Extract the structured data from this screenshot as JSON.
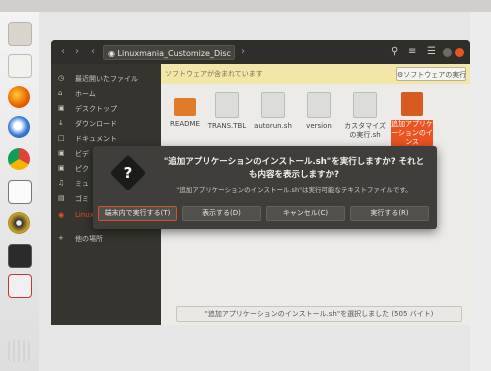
{
  "window": {
    "path_label": "Linuxmania_Customize_Disc"
  },
  "sidebar": {
    "items": [
      {
        "label": "最近開いたファイル",
        "icon": "clock-icon"
      },
      {
        "label": "ホーム",
        "icon": "home-icon"
      },
      {
        "label": "デスクトップ",
        "icon": "folder-icon"
      },
      {
        "label": "ダウンロード",
        "icon": "download-icon"
      },
      {
        "label": "ドキュメント",
        "icon": "document-icon"
      },
      {
        "label": "ビデ",
        "icon": "video-icon"
      },
      {
        "label": "ピク",
        "icon": "picture-icon"
      },
      {
        "label": "ミュ",
        "icon": "music-icon"
      },
      {
        "label": "ゴミ",
        "icon": "trash-icon"
      },
      {
        "label": "Linux",
        "icon": "disc-icon"
      },
      {
        "label": "他の場所",
        "icon": "plus-icon"
      }
    ]
  },
  "infobar": {
    "message": "ソフトウェアが含まれています",
    "button_label": "ソフトウェアの実行"
  },
  "files": [
    {
      "name": "README"
    },
    {
      "name": "TRANS.TBL"
    },
    {
      "name": "autorun.sh"
    },
    {
      "name": "version"
    },
    {
      "name": "カスタマイズの実行.sh"
    },
    {
      "name": "追加アプリケーションのインス"
    }
  ],
  "status": {
    "text": "\"追加アプリケーションのインストール.sh\"を選択しました (505 バイト)"
  },
  "dialog": {
    "title": "\"追加アプリケーションのインストール.sh\"を実行しますか? それとも内容を表示しますか?",
    "subtitle": "\"追加アプリケーションのインストール.sh\"は実行可能なテキストファイルです。",
    "buttons": [
      "端末内で実行する(T)",
      "表示する(D)",
      "キャンセル(C)",
      "実行する(R)"
    ]
  },
  "colors": {
    "accent": "#e95420",
    "dialog_bg": "#3f3e3a",
    "infobar_bg": "#f2e6a8",
    "window_bg": "#3c3b37"
  }
}
